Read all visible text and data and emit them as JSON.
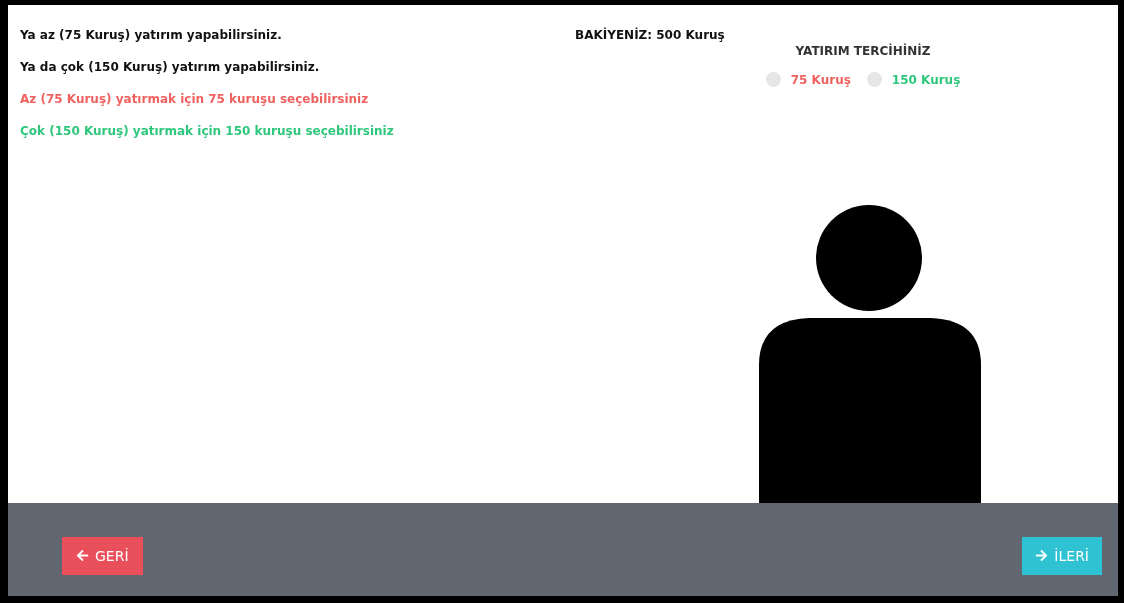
{
  "instructions": [
    {
      "text": "Ya az (75 Kuruş) yatırım yapabilirsiniz.",
      "color": "#111111"
    },
    {
      "text": "Ya da çok (150 Kuruş) yatırım yapabilirsiniz.",
      "color": "#111111"
    },
    {
      "text": "Az (75 Kuruş) yatırmak için 75 kuruşu seçebilirsiniz",
      "color": "#f0625f"
    },
    {
      "text": "Çok (150 Kuruş) yatırmak için 150 kuruşu seçebilirsiniz",
      "color": "#2fc77c"
    }
  ],
  "balance": "BAKİYENİZ: 500 Kuruş",
  "choice": {
    "title": "YATIRIM TERCİHİNİZ",
    "options": [
      {
        "label": "75 Kuruş",
        "selected": false,
        "color": "#f0625f"
      },
      {
        "label": "150 Kuruş",
        "selected": false,
        "color": "#2fc77c"
      }
    ]
  },
  "footer": {
    "back": "GERİ",
    "next": "İLERİ"
  }
}
